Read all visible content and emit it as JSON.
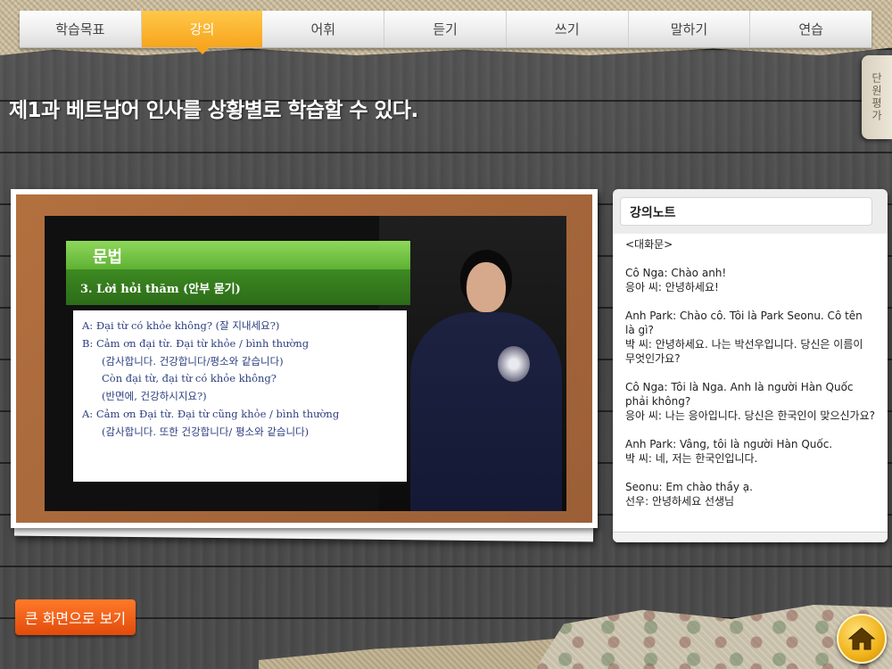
{
  "tabs": [
    {
      "label": "학습목표",
      "active": false
    },
    {
      "label": "강의",
      "active": true
    },
    {
      "label": "어휘",
      "active": false
    },
    {
      "label": "듣기",
      "active": false
    },
    {
      "label": "쓰기",
      "active": false
    },
    {
      "label": "말하기",
      "active": false
    },
    {
      "label": "연습",
      "active": false
    }
  ],
  "page_title": "제1과 베트남어 인사를 상황별로 학습할 수 있다.",
  "side_tab": {
    "label": "단원평가"
  },
  "video": {
    "slide_header": "문법",
    "slide_subtitle": "3. Lời hỏi thăm (안부 묻기)",
    "slide_lines": [
      "A: Đại từ có khỏe không? (잘 지내세요?)",
      "B: Cảm ơn đại từ. Đại từ khỏe / bình thường",
      "(감사합니다. 건강합니다/평소와 같습니다)",
      "Còn đại từ, đại từ có khỏe không?",
      "(반면에, 건강하시지요?)",
      "A: Cảm ơn Đại từ. Đại từ cũng khỏe / bình thường",
      "(감사합니다. 또한 건강합니다/ 평소와 같습니다)"
    ]
  },
  "big_screen_button": "큰 화면으로 보기",
  "notes": {
    "title": "강의노트",
    "paragraphs": [
      "<대화문>",
      "Cô Nga: Chào anh!\n응아 씨: 안녕하세요!",
      "Anh Park: Chào cô. Tôi là Park Seonu. Cô tên là gì?\n박 씨: 안녕하세요. 나는 박선우입니다. 당신은 이름이 무엇인가요?",
      "Cô Nga: Tôi là Nga. Anh là người Hàn Quốc phải không?\n응아 씨: 나는 응아입니다. 당신은 한국인이 맞으신가요?",
      "Anh Park: Vâng, tôi là người Hàn Quốc.\n박 씨: 네, 저는 한국인입니다.",
      "Seonu: Em chào thầy ạ.\n선우: 안녕하세요 선생님"
    ]
  },
  "icons": {
    "home": "home-icon"
  },
  "colors": {
    "active_tab": "#f7a51d",
    "button": "#e24a0a",
    "slide_green": "#5fb134"
  }
}
